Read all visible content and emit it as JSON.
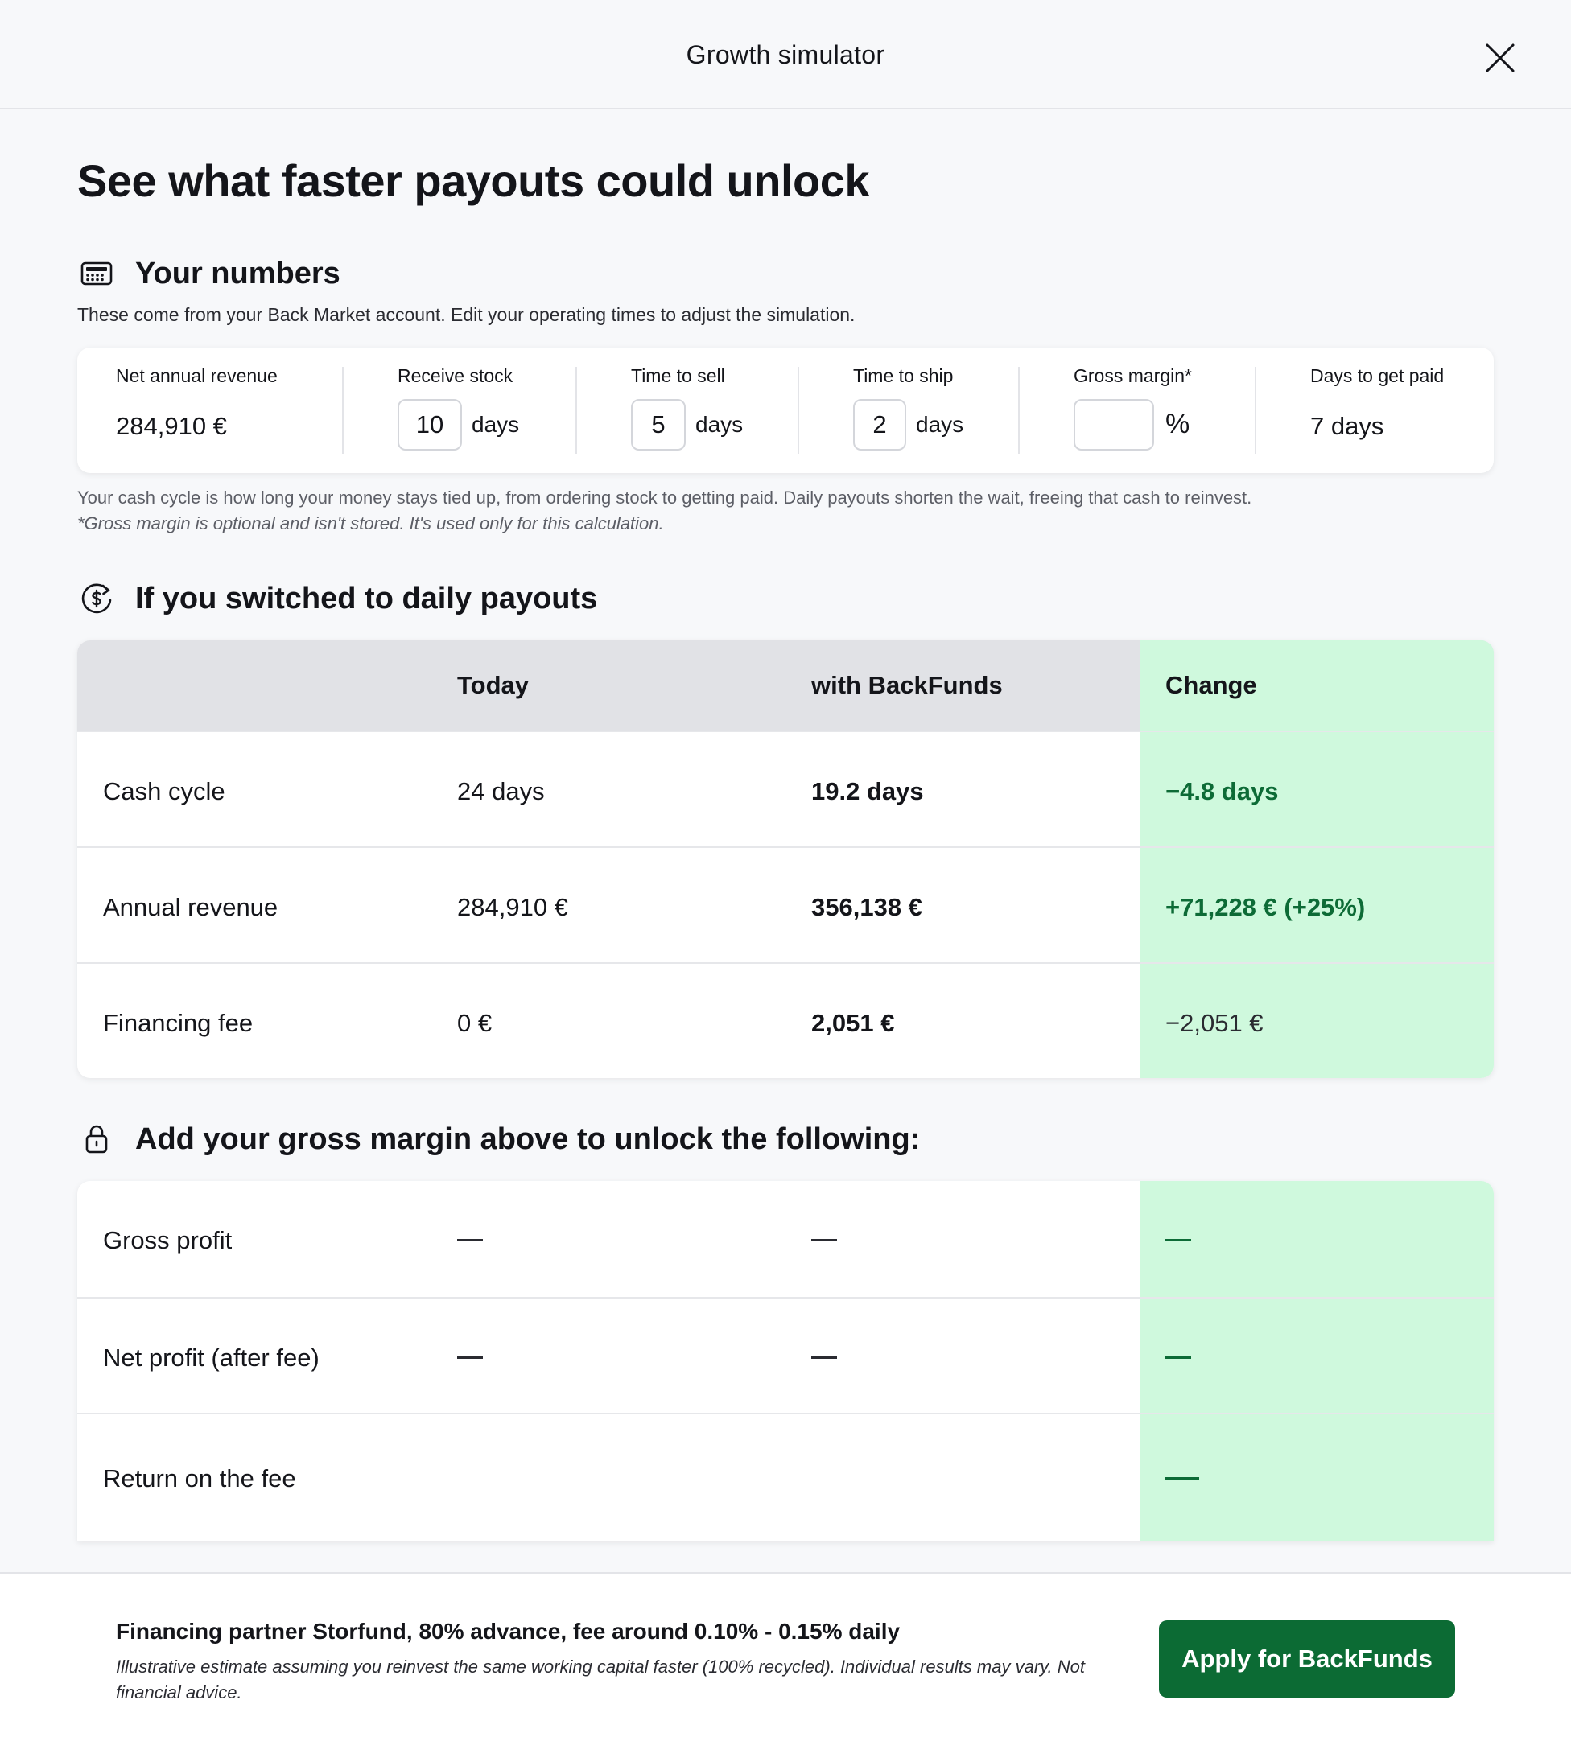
{
  "modal": {
    "title": "Growth simulator"
  },
  "page_title": "See what faster payouts could unlock",
  "your_numbers": {
    "title": "Your numbers",
    "icon": "calculator-icon",
    "subtitle": "These come from your Back Market account. Edit your operating times to adjust the simulation.",
    "fields": {
      "net_annual_revenue": {
        "label": "Net annual revenue",
        "value": "284,910 €"
      },
      "receive_stock": {
        "label": "Receive stock",
        "value": "10",
        "unit": "days"
      },
      "time_to_sell": {
        "label": "Time to sell",
        "value": "5",
        "unit": "days"
      },
      "time_to_ship": {
        "label": "Time to ship",
        "value": "2",
        "unit": "days"
      },
      "gross_margin": {
        "label": "Gross margin*",
        "value": "",
        "unit": "%"
      },
      "days_to_get_paid": {
        "label": "Days to get paid",
        "value": "7 days"
      }
    },
    "note": "Your cash cycle is how long your money stays tied up, from ordering stock to getting paid. Daily payouts shorten the wait, freeing that cash to reinvest.",
    "note_italic": "*Gross margin is optional and isn't stored. It's used only for this calculation."
  },
  "daily_payouts": {
    "title": "If you switched to daily payouts",
    "icon": "dollar-refresh-icon",
    "headers": {
      "today": "Today",
      "with": "with BackFunds",
      "change": "Change"
    },
    "rows": [
      {
        "label": "Cash cycle",
        "today": "24 days",
        "with": "19.2 days",
        "change": "−4.8 days"
      },
      {
        "label": "Annual revenue",
        "today": "284,910 €",
        "with": "356,138 €",
        "change": "+71,228 € (+25%)"
      },
      {
        "label": "Financing fee",
        "today": "0 €",
        "with": "2,051 €",
        "change": "−2,051 €"
      }
    ]
  },
  "locked": {
    "title": "Add your gross margin above to unlock the following:",
    "icon": "lock-icon",
    "rows": [
      {
        "label": "Gross profit"
      },
      {
        "label": "Net profit (after fee)"
      },
      {
        "label": "Return on the fee"
      }
    ]
  },
  "footer": {
    "title": "Financing partner Storfund, 80% advance, fee around 0.10% - 0.15% daily",
    "note": "Illustrative estimate assuming you reinvest the same working capital faster (100% recycled). Individual results may vary. Not financial advice.",
    "cta": "Apply for BackFunds"
  },
  "colors": {
    "accent": "#0c6b34",
    "change_bg": "#cff9dd",
    "header_bg": "#e1e2e6"
  }
}
